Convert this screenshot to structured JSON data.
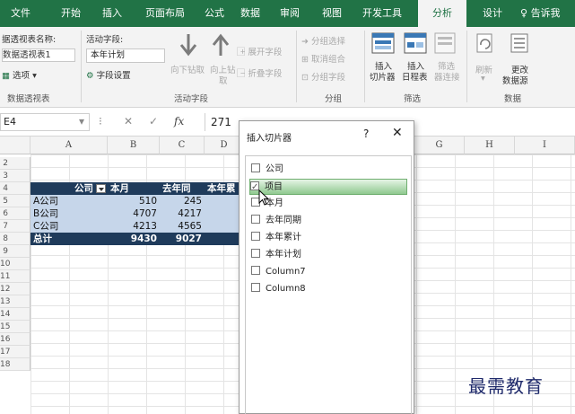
{
  "ribbon_tabs": [
    "文件",
    "开始",
    "插入",
    "页面布局",
    "公式",
    "数据",
    "审阅",
    "视图",
    "开发工具",
    "分析",
    "设计"
  ],
  "active_tab": "分析",
  "tell_me": "告诉我",
  "pivot_group": {
    "name_label": "据透视表名称:",
    "name_value": "数据透视表1",
    "options_label": "选项",
    "group_label": "数据透视表"
  },
  "active_field_group": {
    "field_label": "活动字段:",
    "field_value": "本年计划",
    "field_settings": "字段设置",
    "drill_down": "向下钻取",
    "drill_up_1": "向上钻",
    "drill_up_2": "取",
    "expand_field": "展开字段",
    "collapse_field": "折叠字段",
    "group_label": "活动字段"
  },
  "group_group": {
    "group_selection": "分组选择",
    "ungroup": "取消组合",
    "group_field": "分组字段",
    "group_label": "分组"
  },
  "filter_group": {
    "insert_slicer_1": "插入",
    "insert_slicer_2": "切片器",
    "insert_timeline_1": "插入",
    "insert_timeline_2": "日程表",
    "filter_connections_1": "筛选",
    "filter_connections_2": "器连接",
    "group_label": "筛选"
  },
  "data_group": {
    "refresh": "刷新",
    "change_source_1": "更改",
    "change_source_2": "数据源",
    "group_label": "数据"
  },
  "formula_bar": {
    "name_box": "E4",
    "fx": "fx",
    "value": "271"
  },
  "columns": [
    "A",
    "B",
    "C",
    "D",
    "G",
    "H",
    "I"
  ],
  "row_numbers": [
    "2",
    "3",
    "4",
    "5",
    "6",
    "7",
    "8",
    "9",
    "10",
    "11",
    "12",
    "13",
    "14",
    "15",
    "16",
    "17",
    "18"
  ],
  "pivot": {
    "header": [
      "公司",
      "本月",
      "去年同",
      "本年累"
    ],
    "rows": [
      [
        "A公司",
        "510",
        "245"
      ],
      [
        "B公司",
        "4707",
        "4217"
      ],
      [
        "C公司",
        "4213",
        "4565"
      ]
    ],
    "total": [
      "总计",
      "9430",
      "9027"
    ]
  },
  "dialog": {
    "title": "插入切片器",
    "help": "?",
    "close": "✕",
    "fields": [
      {
        "label": "公司",
        "checked": false
      },
      {
        "label": "项目",
        "checked": true
      },
      {
        "label": "本月",
        "checked": false
      },
      {
        "label": "去年同期",
        "checked": false
      },
      {
        "label": "本年累计",
        "checked": false
      },
      {
        "label": "本年计划",
        "checked": false
      },
      {
        "label": "Column7",
        "checked": false
      },
      {
        "label": "Column8",
        "checked": false
      }
    ],
    "selected_index": 1
  },
  "watermark": "最需教育",
  "colors": {
    "ribbon_green": "#217346",
    "pivot_header": "#1f3b5b",
    "pivot_row": "#c6d6ea",
    "selection_green": "#8fc98f"
  }
}
